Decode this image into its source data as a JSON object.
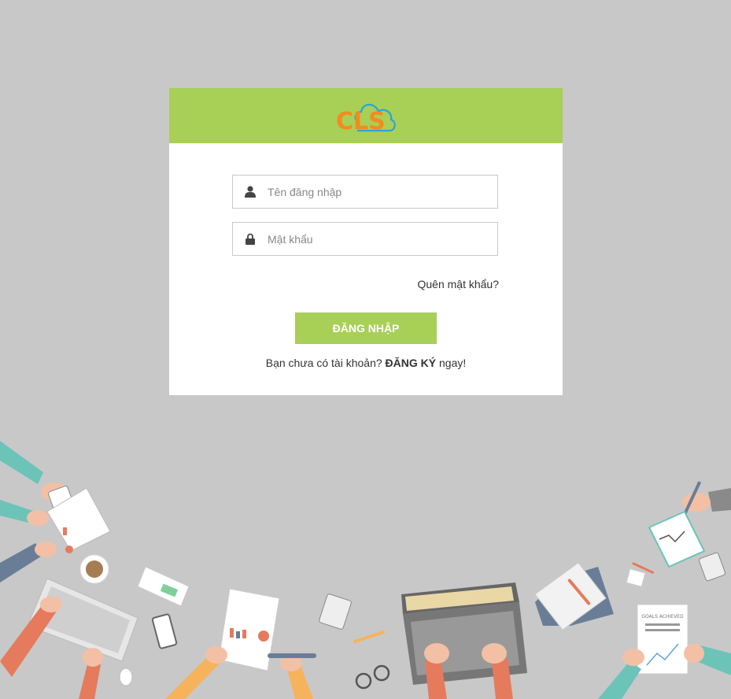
{
  "brand": {
    "logo_text": "CLS",
    "header_color": "#a8cf56",
    "logo_color": "#f58a1f",
    "cloud_color": "#2aa5d8"
  },
  "form": {
    "username_placeholder": "Tên đăng nhập",
    "password_placeholder": "Mật khẩu",
    "username_icon": "user-icon",
    "password_icon": "lock-icon",
    "forgot_label": "Quên mật khẩu?",
    "login_label": "ĐĂNG NHẬP",
    "register_prefix": "Bạn chưa có tài khoản?",
    "register_link": "ĐĂNG KÝ",
    "register_suffix": "ngay!"
  },
  "illustration": {
    "name": "office-desk-illustration",
    "goals_label": "GOALS ACHIEVED"
  }
}
